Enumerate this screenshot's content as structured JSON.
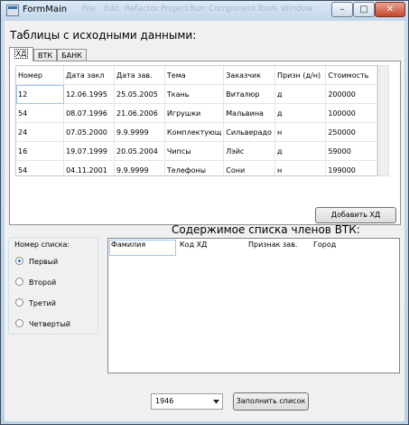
{
  "window": {
    "title": "FormMain",
    "menu_ghost": [
      "File",
      "Edit",
      "Refactor",
      "Project",
      "Run",
      "Component",
      "Tools",
      "Window"
    ],
    "minimize_glyph": "–",
    "maximize_glyph": "□",
    "close_glyph": "✕"
  },
  "source_section": {
    "heading": "Таблицы с исходными данными:",
    "tabs": [
      "ХД",
      "ВТК",
      "БАНК"
    ],
    "grid": {
      "columns": [
        "Номер",
        "Дата закл",
        "Дата зав.",
        "Тема",
        "Заказчик",
        "Призн (д/н)",
        "Стоимость"
      ],
      "rows": [
        [
          "12",
          "12.06.1995",
          "25.05.2005",
          "Ткань",
          "Виталюр",
          "д",
          "200000"
        ],
        [
          "54",
          "08.07.1996",
          "21.06.2006",
          "Игрушки",
          "Мальвина",
          "д",
          "100000"
        ],
        [
          "24",
          "07.05.2000",
          "9.9.9999",
          "Комплектующ",
          "Сильверадо",
          "н",
          "250000"
        ],
        [
          "16",
          "19.07.1999",
          "20.05.2004",
          "Чипсы",
          "Лэйс",
          "д",
          "59000"
        ],
        [
          "54",
          "04.11.2001",
          "9.9.9999",
          "Телефоны",
          "Сони",
          "н",
          "199000"
        ]
      ]
    },
    "add_button": "Добавить ХД"
  },
  "list_selector": {
    "label": "Номер списка:",
    "options": [
      "Первый",
      "Второй",
      "Третий",
      "Четвертый"
    ],
    "selected": "Первый"
  },
  "members_section": {
    "heading": "Содержимое списка членов ВТК:",
    "columns": [
      "Фамилия",
      "Код ХД",
      "Признак зав.",
      "Город"
    ]
  },
  "footer": {
    "year_value": "1946",
    "fill_button": "Заполнить список"
  },
  "icons": {
    "app": "form-app-icon",
    "dropdown": "chevron-down-icon"
  },
  "colors": {
    "title_bar": "#c9dcef",
    "close_button": "#c7462e",
    "form_background": "#f0f0f0",
    "selection_border": "#9ec6ef",
    "radio_dot": "#1e66c8"
  }
}
